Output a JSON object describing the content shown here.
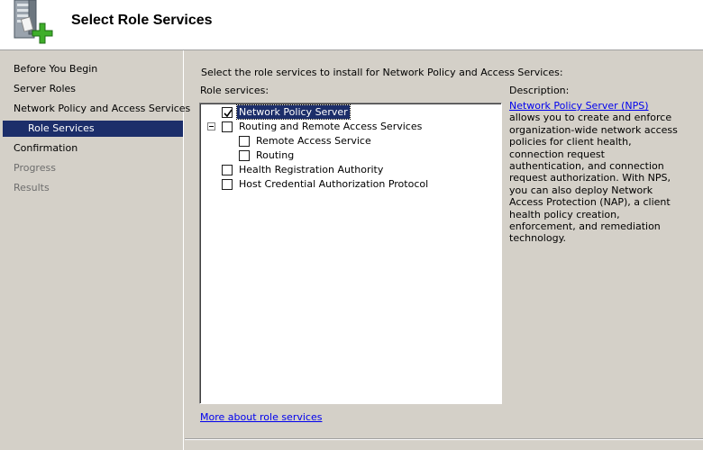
{
  "header": {
    "title": "Select Role Services",
    "icon": "server-add-icon"
  },
  "nav": {
    "items": [
      {
        "label": "Before You Begin",
        "state": "normal"
      },
      {
        "label": "Server Roles",
        "state": "normal"
      },
      {
        "label": "Network Policy and Access Services",
        "state": "normal"
      },
      {
        "label": "Role Services",
        "state": "active"
      },
      {
        "label": "Confirmation",
        "state": "normal"
      },
      {
        "label": "Progress",
        "state": "disabled"
      },
      {
        "label": "Results",
        "state": "disabled"
      }
    ]
  },
  "main": {
    "instruction": "Select the role services to install for Network Policy and Access Services:",
    "role_services_label": "Role services:",
    "tree": [
      {
        "label": "Network Policy Server",
        "checked": true,
        "selected": true
      },
      {
        "label": "Routing and Remote Access Services",
        "checked": false,
        "expanded": true
      },
      {
        "label": "Remote Access Service",
        "checked": false
      },
      {
        "label": "Routing",
        "checked": false
      },
      {
        "label": "Health Registration Authority",
        "checked": false
      },
      {
        "label": "Host Credential Authorization Protocol",
        "checked": false
      }
    ],
    "description_label": "Description:",
    "description_link": "Network Policy Server (NPS)",
    "description_text": " allows you to create and enforce organization-wide network access policies for client health, connection request authentication, and connection request authorization. With NPS, you can also deploy Network Access Protection (NAP), a client health policy creation, enforcement, and remediation technology.",
    "more_link": "More about role services"
  },
  "colors": {
    "selection": "#1c2e6a",
    "link": "#0000ee",
    "panel": "#d4d0c8"
  }
}
